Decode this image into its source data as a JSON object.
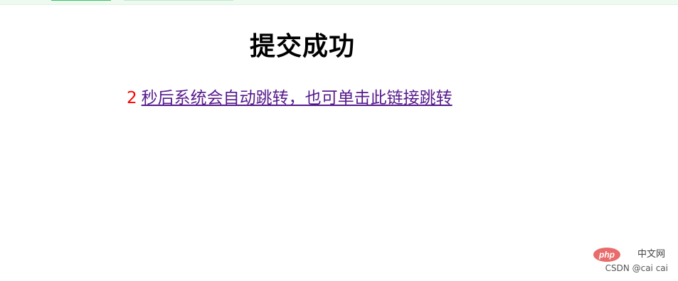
{
  "page": {
    "title": "提交成功",
    "countdown": "2",
    "link_text": "秒后系统会自动跳转，也可单击此链接跳转"
  },
  "watermark": {
    "logo_text": "php",
    "site_name": "中文网",
    "credit": "CSDN @cai  cai"
  },
  "colors": {
    "countdown": "#ff0000",
    "visited_link": "#551a8b",
    "logo": "#e96b6b"
  }
}
